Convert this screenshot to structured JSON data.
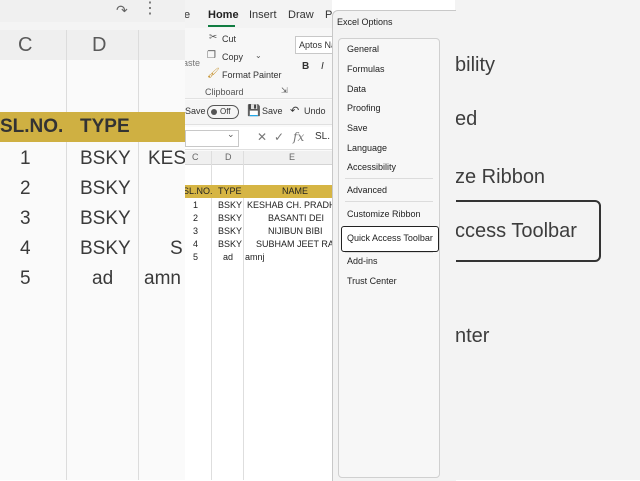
{
  "background_left": {
    "columns": [
      "C",
      "D"
    ],
    "header_row": [
      "SL.NO.",
      "TYPE"
    ],
    "rows": [
      [
        "1",
        "BSKY",
        "KES"
      ],
      [
        "2",
        "BSKY",
        ""
      ],
      [
        "3",
        "BSKY",
        ""
      ],
      [
        "4",
        "BSKY",
        "S"
      ],
      [
        "5",
        "ad",
        "amn"
      ]
    ]
  },
  "background_right": {
    "items": [
      "bility",
      "ed",
      "ze Ribbon",
      "ccess Toolbar",
      "nter"
    ]
  },
  "excel": {
    "tabs": [
      "e",
      "Home",
      "Insert",
      "Draw",
      "P"
    ],
    "active_tab": "Home",
    "ribbon": {
      "cut": "Cut",
      "copy": "Copy",
      "format_painter": "Format Painter",
      "paste_fragment": "aste",
      "clipboard_group": "Clipboard",
      "font_name": "Aptos Na",
      "bold": "B",
      "italic": "I"
    },
    "qat": {
      "autosave_label": "Save",
      "autosave_state": "Off",
      "save_label": "Save",
      "undo_label": "Undo"
    },
    "formula_bar": {
      "cancel": "✕",
      "enter": "✓",
      "fx": "fx",
      "value": "SL."
    },
    "sheet": {
      "columns": [
        "C",
        "D",
        "E"
      ],
      "header_row": [
        "SL.NO.",
        "TYPE",
        "NAME"
      ],
      "rows": [
        [
          "1",
          "BSKY",
          "KESHAB CH. PRADHA"
        ],
        [
          "2",
          "BSKY",
          "BASANTI DEI"
        ],
        [
          "3",
          "BSKY",
          "NIJIBUN BIBI"
        ],
        [
          "4",
          "BSKY",
          "SUBHAM JEET RAM"
        ],
        [
          "5",
          "ad",
          "amnj"
        ]
      ]
    }
  },
  "dialog": {
    "title": "Excel Options",
    "nav": [
      "General",
      "Formulas",
      "Data",
      "Proofing",
      "Save",
      "Language",
      "Accessibility",
      "Advanced",
      "Customize Ribbon",
      "Quick Access Toolbar",
      "Add-ins",
      "Trust Center"
    ],
    "selected": "Quick Access Toolbar"
  }
}
